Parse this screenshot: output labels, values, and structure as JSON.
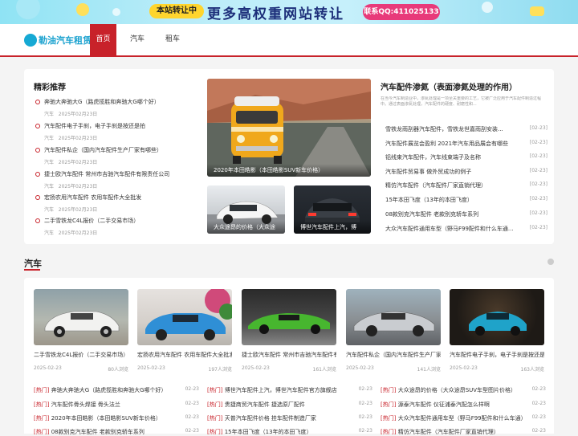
{
  "banner": {
    "tag": "本站转让中",
    "headline": "更多高权重网站转让",
    "qq": "联系QQ:411025133"
  },
  "header": {
    "logo_text": "勒油汽车租赁",
    "nav": [
      "首页",
      "汽车",
      "租车"
    ]
  },
  "featured": {
    "heading": "精彩推荐",
    "items": [
      {
        "title": "奔驰大奔驰大G（路虎揽胜和奔驰大G哪个好）",
        "cat": "汽车",
        "date": "2025年02月23日"
      },
      {
        "title": "汽车配件电子手刹，电子手刹是按还是拍",
        "cat": "汽车",
        "date": "2025年02月23日"
      },
      {
        "title": "汽车配件私企（国内汽车配件生产厂家有哪些）",
        "cat": "汽车",
        "date": "2025年02月23日"
      },
      {
        "title": "捷士欧汽车配件 常州市吉驰汽车配件有限责任公司",
        "cat": "汽车",
        "date": "2025年02月23日"
      },
      {
        "title": "宏扬农用汽车配件 农用车配件大全批发",
        "cat": "汽车",
        "date": "2025年02月23日"
      },
      {
        "title": "二手雪铁龙C4L报价（二手交易市场）",
        "cat": "汽车",
        "date": "2025年02月23日"
      }
    ]
  },
  "hero": {
    "main_caption": "2020年本田皓影（本田皓影SUV新车价格）",
    "small1_caption": "大众途昂的价格（大众途",
    "small2_caption": "博世汽车配件上汽，博"
  },
  "right": {
    "heading": "汽车配件渗氮（表面渗氮处理的作用）",
    "summary": "在当今汽车制造业中，渗氮处理是一项至关重要的工艺，它被广泛应用于汽车配件制造过程中。通过表面渗氮处理，汽车配件的硬度、耐磨性和...",
    "items": [
      {
        "title": "雪铁龙雨刮器汽车配件，雪铁龙世嘉雨刮安装...",
        "date": "[02-23]"
      },
      {
        "title": "汽车配件展览会盈利 2021年汽车用品展会有哪些",
        "date": "[02-23]"
      },
      {
        "title": "铝线束汽车配件，汽车线束端子及名称",
        "date": "[02-23]"
      },
      {
        "title": "汽车配件贸易事 做外贸成功的例子",
        "date": "[02-23]"
      },
      {
        "title": "精仿汽车配件（汽车配件厂家直销代理）",
        "date": "[02-23]"
      },
      {
        "title": "15年本田飞度（13年的本田飞度）",
        "date": "[02-23]"
      },
      {
        "title": "08款别克汽车配件 老款别克轿车系列",
        "date": "[02-23]"
      },
      {
        "title": "大众汽车配件通用车型（野马F99配件和什么车通...",
        "date": "[02-23]"
      }
    ]
  },
  "section": {
    "title": "汽车",
    "cards": [
      {
        "title": "二手雪铁龙C4L报价（二手交易市场）",
        "date": "2025-02-23",
        "views": "80人浏览"
      },
      {
        "title": "宏扬农用汽车配件 农用车配件大全批发",
        "date": "2025-02-23",
        "views": "197人浏览"
      },
      {
        "title": "捷士欧汽车配件 常州市吉驰汽车配件有限责任公司",
        "date": "2025-02-23",
        "views": "161人浏览"
      },
      {
        "title": "汽车配件私企（国内汽车配件生产厂家有哪些）",
        "date": "2025-02-23",
        "views": "141人浏览"
      },
      {
        "title": "汽车配件电子手刹，电子手刹是按还是拍",
        "date": "2025-02-23",
        "views": "163人浏览"
      }
    ],
    "text_cols": [
      [
        {
          "tag": "[热门]",
          "title": "奔驰大奔驰大G（路虎揽胜和奔驰大G哪个好）",
          "date": "02-23"
        },
        {
          "tag": "[热门]",
          "title": "汽车配件骨头焊接 骨头法兰",
          "date": "02-23"
        },
        {
          "tag": "[热门]",
          "title": "2020年本田皓影（本田皓影SUV新车价格）",
          "date": "02-23"
        },
        {
          "tag": "[热门]",
          "title": "08款别克汽车配件 老款别克轿车系列",
          "date": "02-23"
        }
      ],
      [
        {
          "tag": "[热门]",
          "title": "博世汽车配件上汽，博世汽车配件官方旗舰店",
          "date": "02-23"
        },
        {
          "tag": "[热门]",
          "title": "贵捷商贸汽车配件 捷选原厂配件",
          "date": "02-23"
        },
        {
          "tag": "[热门]",
          "title": "天普汽车配件价格 挂车配件制造厂家",
          "date": "02-23"
        },
        {
          "tag": "[热门]",
          "title": "15年本田飞度（13年的本田飞度）",
          "date": "02-23"
        }
      ],
      [
        {
          "tag": "[热门]",
          "title": "大众途昂的价格（大众途昂SUV车型图片价格）",
          "date": "02-23"
        },
        {
          "tag": "[热门]",
          "title": "源泰汽车配件 仪征浦泰汽配怎么样啊",
          "date": "02-23"
        },
        {
          "tag": "[热门]",
          "title": "大众汽车配件通用车型（野马F99配件和什么车通）",
          "date": "02-23"
        },
        {
          "tag": "[热门]",
          "title": "精仿汽车配件（汽车配件厂家直销代理）",
          "date": "02-23"
        }
      ]
    ]
  }
}
